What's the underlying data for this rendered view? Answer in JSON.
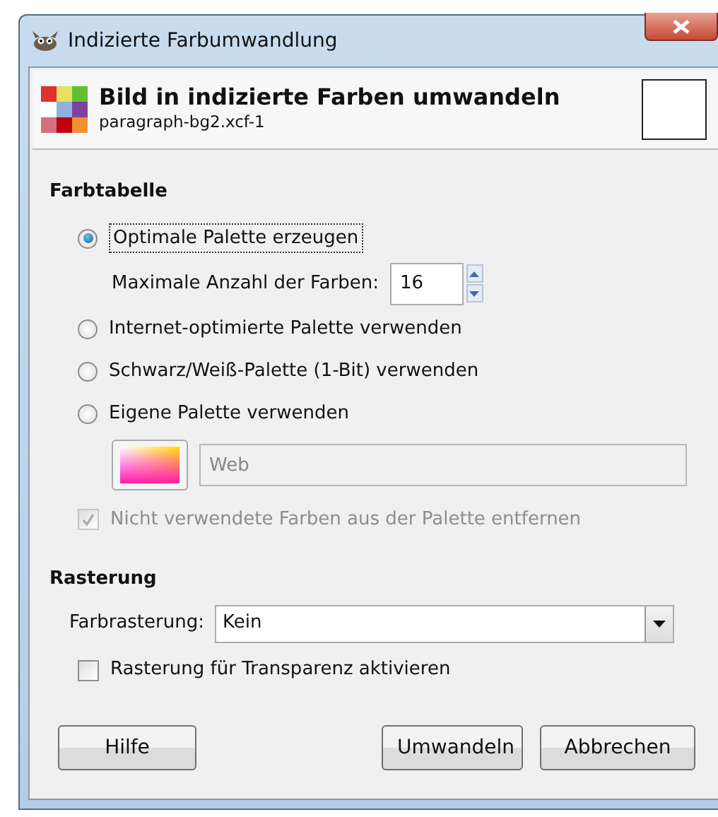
{
  "window": {
    "title": "Indizierte Farbumwandlung"
  },
  "header": {
    "title": "Bild in indizierte Farben umwandeln",
    "subtitle": "paragraph-bg2.xcf-1"
  },
  "colormap": {
    "heading": "Farbtabelle",
    "options": [
      {
        "label": "Optimale Palette erzeugen",
        "selected": true
      },
      {
        "label": "Internet-optimierte Palette verwenden",
        "selected": false
      },
      {
        "label": "Schwarz/Weiß-Palette (1-Bit) verwenden",
        "selected": false
      },
      {
        "label": "Eigene Palette verwenden",
        "selected": false
      }
    ],
    "max_colors": {
      "label": "Maximale Anzahl der Farben:",
      "value": "16"
    },
    "custom_palette": {
      "value": "Web",
      "disabled": true
    },
    "remove_unused": {
      "label": "Nicht verwendete Farben aus der Palette entfernen",
      "checked": true,
      "disabled": true
    }
  },
  "dithering": {
    "heading": "Rasterung",
    "color_dithering": {
      "label": "Farbrasterung:",
      "value": "Kein"
    },
    "transparency": {
      "label": "Rasterung für Transparenz aktivieren",
      "checked": false
    }
  },
  "help_button": "Hilfe",
  "action_buttons": [
    "Umwandeln",
    "Abbrechen"
  ]
}
